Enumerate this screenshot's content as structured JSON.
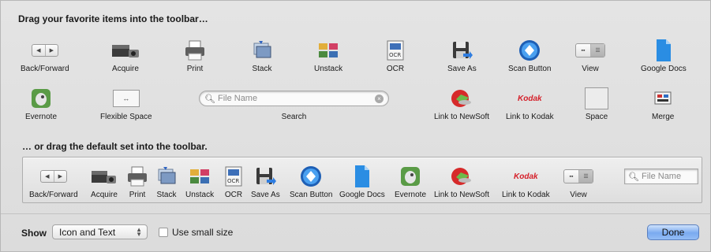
{
  "headings": {
    "drag_favorites": "Drag your favorite items into the toolbar…",
    "drag_default": "… or drag the default set into the toolbar."
  },
  "palette": {
    "back_forward": "Back/Forward",
    "acquire": "Acquire",
    "print": "Print",
    "stack": "Stack",
    "unstack": "Unstack",
    "ocr": "OCR",
    "save_as": "Save As",
    "scan_button": "Scan Button",
    "view": "View",
    "google_docs": "Google Docs",
    "evernote": "Evernote",
    "flexible_space": "Flexible Space",
    "search": "Search",
    "search_placeholder": "File Name",
    "link_newsoft": "Link to NewSoft",
    "link_kodak": "Link to Kodak",
    "space": "Space",
    "merge": "Merge",
    "kodak_logo": "Kodak"
  },
  "default_set": {
    "back_forward": "Back/Forward",
    "acquire": "Acquire",
    "print": "Print",
    "stack": "Stack",
    "unstack": "Unstack",
    "ocr": "OCR",
    "save_as": "Save As",
    "scan_button": "Scan Button",
    "google_docs": "Google Docs",
    "evernote": "Evernote",
    "link_newsoft": "Link to NewSoft",
    "link_kodak": "Link to Kodak",
    "view": "View",
    "search_placeholder": "File Name",
    "kodak_logo": "Kodak"
  },
  "bottom": {
    "show_label": "Show",
    "show_value": "Icon and Text",
    "small_size_label": "Use small size",
    "small_size_checked": false,
    "done_label": "Done"
  },
  "colors": {
    "done_button": "#7aaaf0",
    "google_docs": "#2a8de3",
    "evernote": "#5a9b46",
    "kodak": "#d5202a"
  }
}
